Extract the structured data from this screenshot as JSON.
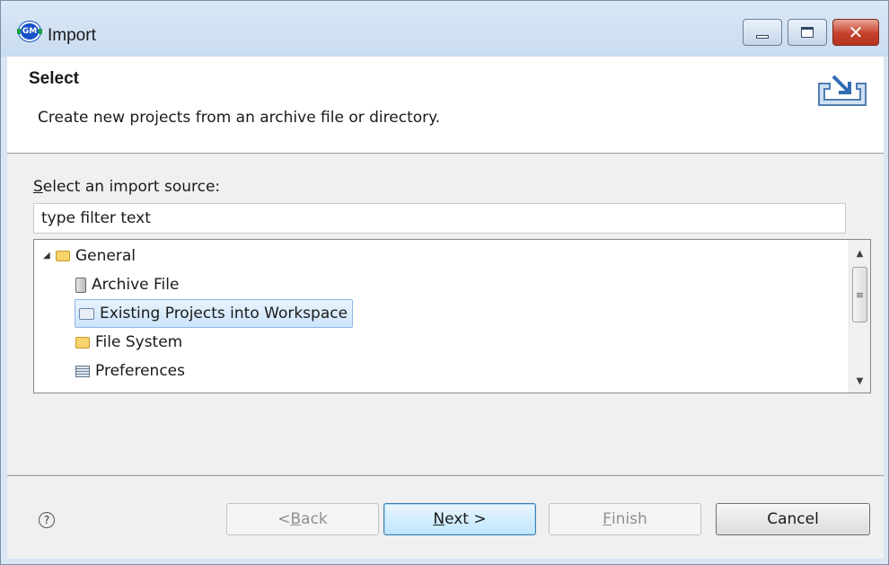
{
  "window": {
    "title": "Import",
    "controls": {
      "minimize": "minimize",
      "maximize": "maximize",
      "close": "✕"
    }
  },
  "banner": {
    "title": "Select",
    "description": "Create new projects from an archive file or directory.",
    "icon": "import-wizard-icon"
  },
  "source": {
    "label_mnemonic": "S",
    "label_rest": "elect an import source:",
    "filter_value": "type filter text"
  },
  "tree": {
    "root": {
      "label": "General",
      "icon": "folder-open-icon",
      "expanded": true
    },
    "items": [
      {
        "label": "Archive File",
        "icon": "archive-file-icon"
      },
      {
        "label": "Existing Projects into Workspace",
        "icon": "project-icon",
        "selected": true
      },
      {
        "label": "File System",
        "icon": "folder-icon"
      },
      {
        "label": "Preferences",
        "icon": "preferences-icon"
      }
    ]
  },
  "buttons": {
    "back_prefix": "< ",
    "back_mnemonic": "B",
    "back_rest": "ack",
    "next_mnemonic": "N",
    "next_rest": "ext >",
    "finish_mnemonic": "F",
    "finish_rest": "inish",
    "cancel": "Cancel"
  },
  "help": {
    "glyph": "?"
  },
  "colors": {
    "title_bar": "#c9dcf0",
    "selection": "#cce4fb",
    "close_button": "#c4402a",
    "dialog_bg": "#f0f0f0"
  }
}
